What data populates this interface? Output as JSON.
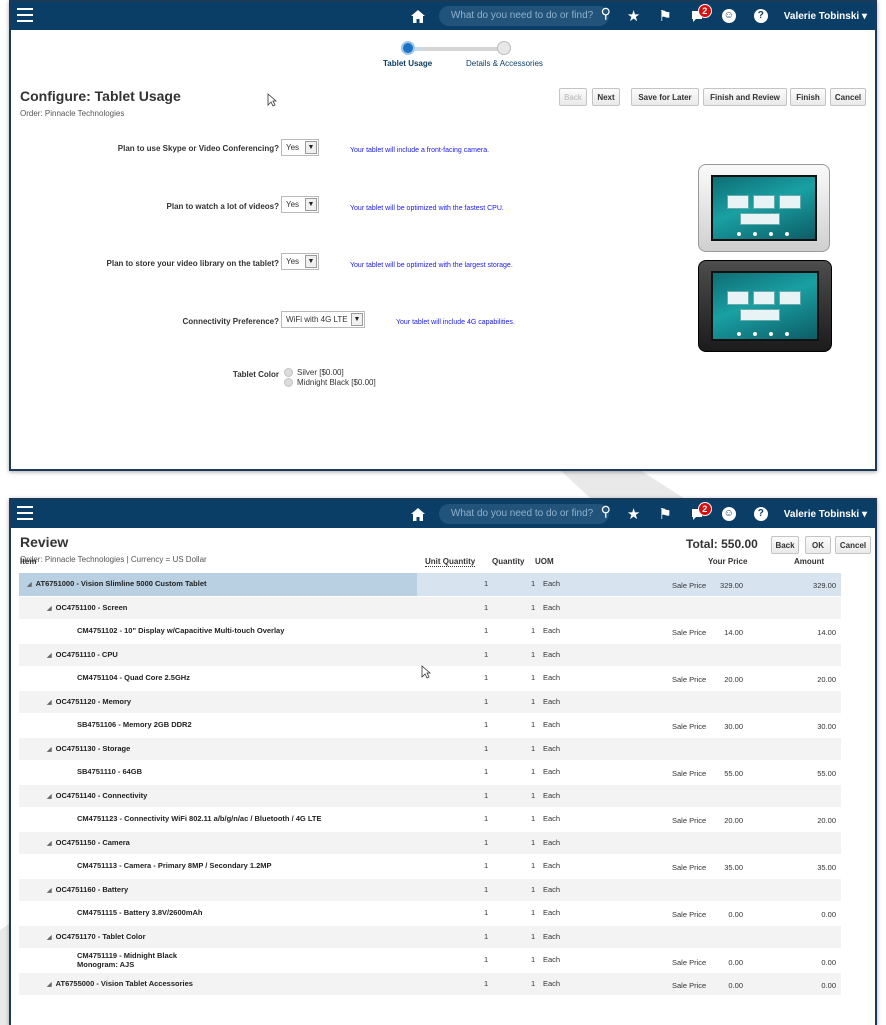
{
  "nav": {
    "search_placeholder": "What do you need to do or find?",
    "notification_count": "2",
    "user_name": "Valerie Tobinski",
    "icons": [
      "menu-icon",
      "home-icon",
      "search-icon",
      "star-icon",
      "flag-icon",
      "notifications-icon",
      "accessibility-icon",
      "help-icon"
    ]
  },
  "configure": {
    "train": {
      "steps": [
        "Tablet Usage",
        "Details & Accessories"
      ],
      "current": "Tablet Usage"
    },
    "title": "Configure: Tablet Usage",
    "subtitle": "Order: Pinnacle Technologies",
    "buttons": {
      "back": "Back",
      "next": "Next",
      "save_later": "Save for Later",
      "finish_review": "Finish and Review",
      "finish": "Finish",
      "cancel": "Cancel"
    },
    "questions": [
      {
        "label": "Plan to use Skype or Video Conferencing?",
        "value": "Yes",
        "hint": "Your tablet will include a front-facing camera."
      },
      {
        "label": "Plan to watch a lot of videos?",
        "value": "Yes",
        "hint": "Your tablet will be optimized with the fastest CPU."
      },
      {
        "label": "Plan to store your video library on the tablet?",
        "value": "Yes",
        "hint": "Your tablet will be optimized with the largest storage."
      },
      {
        "label": "Connectivity Preference?",
        "value": "WiFi with 4G LTE",
        "hint": "Your tablet will include 4G capabilities."
      }
    ],
    "color": {
      "label": "Tablet Color",
      "options": [
        "Silver [$0.00]",
        "Midnight Black [$0.00]"
      ]
    }
  },
  "review": {
    "title": "Review",
    "subtitle": "Order: Pinnacle Technologies | Currency = US Dollar",
    "total_label": "Total:",
    "total_value": "550.00",
    "buttons": {
      "back": "Back",
      "ok": "OK",
      "cancel": "Cancel"
    },
    "columns": {
      "item": "Item",
      "unit_qty": "Unit Quantity",
      "qty": "Quantity",
      "uom": "UOM",
      "price": "Your Price",
      "amount": "Amount"
    },
    "rows": [
      {
        "item": "AT6751000 - Vision Slimline 5000 Custom Tablet",
        "level": 0,
        "expander": true,
        "unit_qty": "1",
        "qty": "1",
        "uom": "Each",
        "price_type": "Sale Price",
        "price": "329.00",
        "amount": "329.00"
      },
      {
        "item": "OC4751100 - Screen",
        "level": 1,
        "expander": true,
        "unit_qty": "1",
        "qty": "1",
        "uom": "Each",
        "price_type": "",
        "price": "",
        "amount": ""
      },
      {
        "item": "CM4751102 - 10\" Display w/Capacitive Multi-touch Overlay",
        "level": 2,
        "expander": false,
        "unit_qty": "1",
        "qty": "1",
        "uom": "Each",
        "price_type": "Sale Price",
        "price": "14.00",
        "amount": "14.00"
      },
      {
        "item": "OC4751110 - CPU",
        "level": 1,
        "expander": true,
        "unit_qty": "1",
        "qty": "1",
        "uom": "Each",
        "price_type": "",
        "price": "",
        "amount": ""
      },
      {
        "item": "CM4751104 - Quad Core 2.5GHz",
        "level": 2,
        "expander": false,
        "unit_qty": "1",
        "qty": "1",
        "uom": "Each",
        "price_type": "Sale Price",
        "price": "20.00",
        "amount": "20.00"
      },
      {
        "item": "OC4751120 - Memory",
        "level": 1,
        "expander": true,
        "unit_qty": "1",
        "qty": "1",
        "uom": "Each",
        "price_type": "",
        "price": "",
        "amount": ""
      },
      {
        "item": "SB4751106 - Memory 2GB DDR2",
        "level": 2,
        "expander": false,
        "unit_qty": "1",
        "qty": "1",
        "uom": "Each",
        "price_type": "Sale Price",
        "price": "30.00",
        "amount": "30.00"
      },
      {
        "item": "OC4751130 - Storage",
        "level": 1,
        "expander": true,
        "unit_qty": "1",
        "qty": "1",
        "uom": "Each",
        "price_type": "",
        "price": "",
        "amount": ""
      },
      {
        "item": "SB4751110 - 64GB",
        "level": 2,
        "expander": false,
        "unit_qty": "1",
        "qty": "1",
        "uom": "Each",
        "price_type": "Sale Price",
        "price": "55.00",
        "amount": "55.00"
      },
      {
        "item": "OC4751140 - Connectivity",
        "level": 1,
        "expander": true,
        "unit_qty": "1",
        "qty": "1",
        "uom": "Each",
        "price_type": "",
        "price": "",
        "amount": ""
      },
      {
        "item": "CM4751123 - Connectivity WiFi 802.11 a/b/g/n/ac / Bluetooth / 4G LTE",
        "level": 2,
        "expander": false,
        "unit_qty": "1",
        "qty": "1",
        "uom": "Each",
        "price_type": "Sale Price",
        "price": "20.00",
        "amount": "20.00"
      },
      {
        "item": "OC4751150 - Camera",
        "level": 1,
        "expander": true,
        "unit_qty": "1",
        "qty": "1",
        "uom": "Each",
        "price_type": "",
        "price": "",
        "amount": ""
      },
      {
        "item": "CM4751113 - Camera - Primary 8MP / Secondary 1.2MP",
        "level": 2,
        "expander": false,
        "unit_qty": "1",
        "qty": "1",
        "uom": "Each",
        "price_type": "Sale Price",
        "price": "35.00",
        "amount": "35.00"
      },
      {
        "item": "OC4751160 - Battery",
        "level": 1,
        "expander": true,
        "unit_qty": "1",
        "qty": "1",
        "uom": "Each",
        "price_type": "",
        "price": "",
        "amount": ""
      },
      {
        "item": "CM4751115 - Battery 3.8V/2600mAh",
        "level": 2,
        "expander": false,
        "unit_qty": "1",
        "qty": "1",
        "uom": "Each",
        "price_type": "Sale Price",
        "price": "0.00",
        "amount": "0.00"
      },
      {
        "item": "OC4751170 - Tablet Color",
        "level": 1,
        "expander": true,
        "unit_qty": "1",
        "qty": "1",
        "uom": "Each",
        "price_type": "",
        "price": "",
        "amount": ""
      },
      {
        "item": "CM4751119 - Midnight Black",
        "item2": "Monogram: AJS",
        "level": 2,
        "expander": false,
        "unit_qty": "1",
        "qty": "1",
        "uom": "Each",
        "price_type": "Sale Price",
        "price": "0.00",
        "amount": "0.00"
      },
      {
        "item": "AT6755000 - Vision Tablet Accessories",
        "level": 1,
        "expander": true,
        "unit_qty": "1",
        "qty": "1",
        "uom": "Each",
        "price_type": "Sale Price",
        "price": "0.00",
        "amount": "0.00"
      }
    ]
  }
}
